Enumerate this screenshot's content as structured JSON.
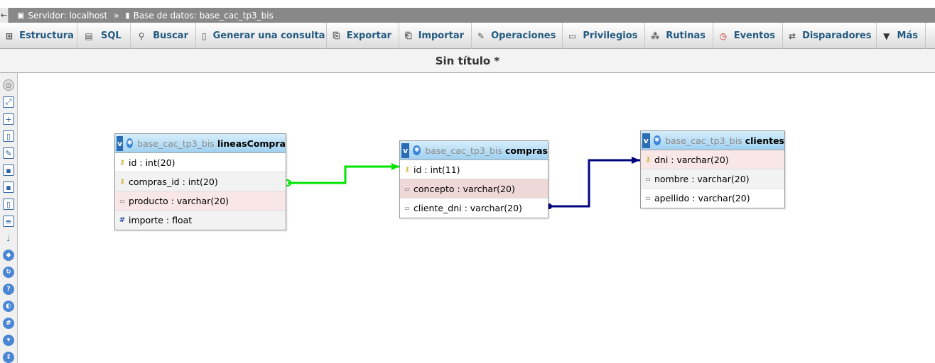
{
  "breadcrumb": {
    "back_icon": "back-arrow-icon",
    "server": "Servidor: localhost",
    "separator": "»",
    "database": "Base de datos: base_cac_tp3_bis"
  },
  "tabs": [
    {
      "label": "Estructura",
      "icon": "structure-icon"
    },
    {
      "label": "SQL",
      "icon": "sql-icon"
    },
    {
      "label": "Buscar",
      "icon": "search-icon"
    },
    {
      "label": "Generar una consulta",
      "icon": "query-icon"
    },
    {
      "label": "Exportar",
      "icon": "export-icon"
    },
    {
      "label": "Importar",
      "icon": "import-icon"
    },
    {
      "label": "Operaciones",
      "icon": "wrench-icon"
    },
    {
      "label": "Privilegios",
      "icon": "privileges-icon"
    },
    {
      "label": "Rutinas",
      "icon": "routines-icon"
    },
    {
      "label": "Eventos",
      "icon": "clock-icon"
    },
    {
      "label": "Disparadores",
      "icon": "triggers-icon"
    },
    {
      "label": "Más",
      "icon": "chevron-down-icon"
    }
  ],
  "designer_title": "Sin título *",
  "tables": [
    {
      "db": "base_cac_tp3_bis",
      "name": "lineasCompra",
      "toggle": "v",
      "fields": [
        {
          "text": "id : int(20)",
          "icon": "key"
        },
        {
          "text": "compras_id : int(20)",
          "icon": "key"
        },
        {
          "text": "producto : varchar(20)",
          "icon": "text"
        },
        {
          "text": "importe : float",
          "icon": "number"
        }
      ]
    },
    {
      "db": "base_cac_tp3_bis",
      "name": "compras",
      "toggle": "v",
      "fields": [
        {
          "text": "id : int(11)",
          "icon": "key"
        },
        {
          "text": "concepto : varchar(20)",
          "icon": "text"
        },
        {
          "text": "cliente_dni : varchar(20)",
          "icon": "text"
        }
      ]
    },
    {
      "db": "base_cac_tp3_bis",
      "name": "clientes",
      "toggle": "v",
      "fields": [
        {
          "text": "dni : varchar(20)",
          "icon": "key"
        },
        {
          "text": "nombre : varchar(20)",
          "icon": "text"
        },
        {
          "text": "apellido : varchar(20)",
          "icon": "text"
        }
      ]
    }
  ],
  "relations": [
    {
      "from": "lineasCompra.compras_id",
      "to": "compras.id",
      "color": "#00e600"
    },
    {
      "from": "compras.cliente_dni",
      "to": "clientes.dni",
      "color": "#00007f"
    }
  ]
}
